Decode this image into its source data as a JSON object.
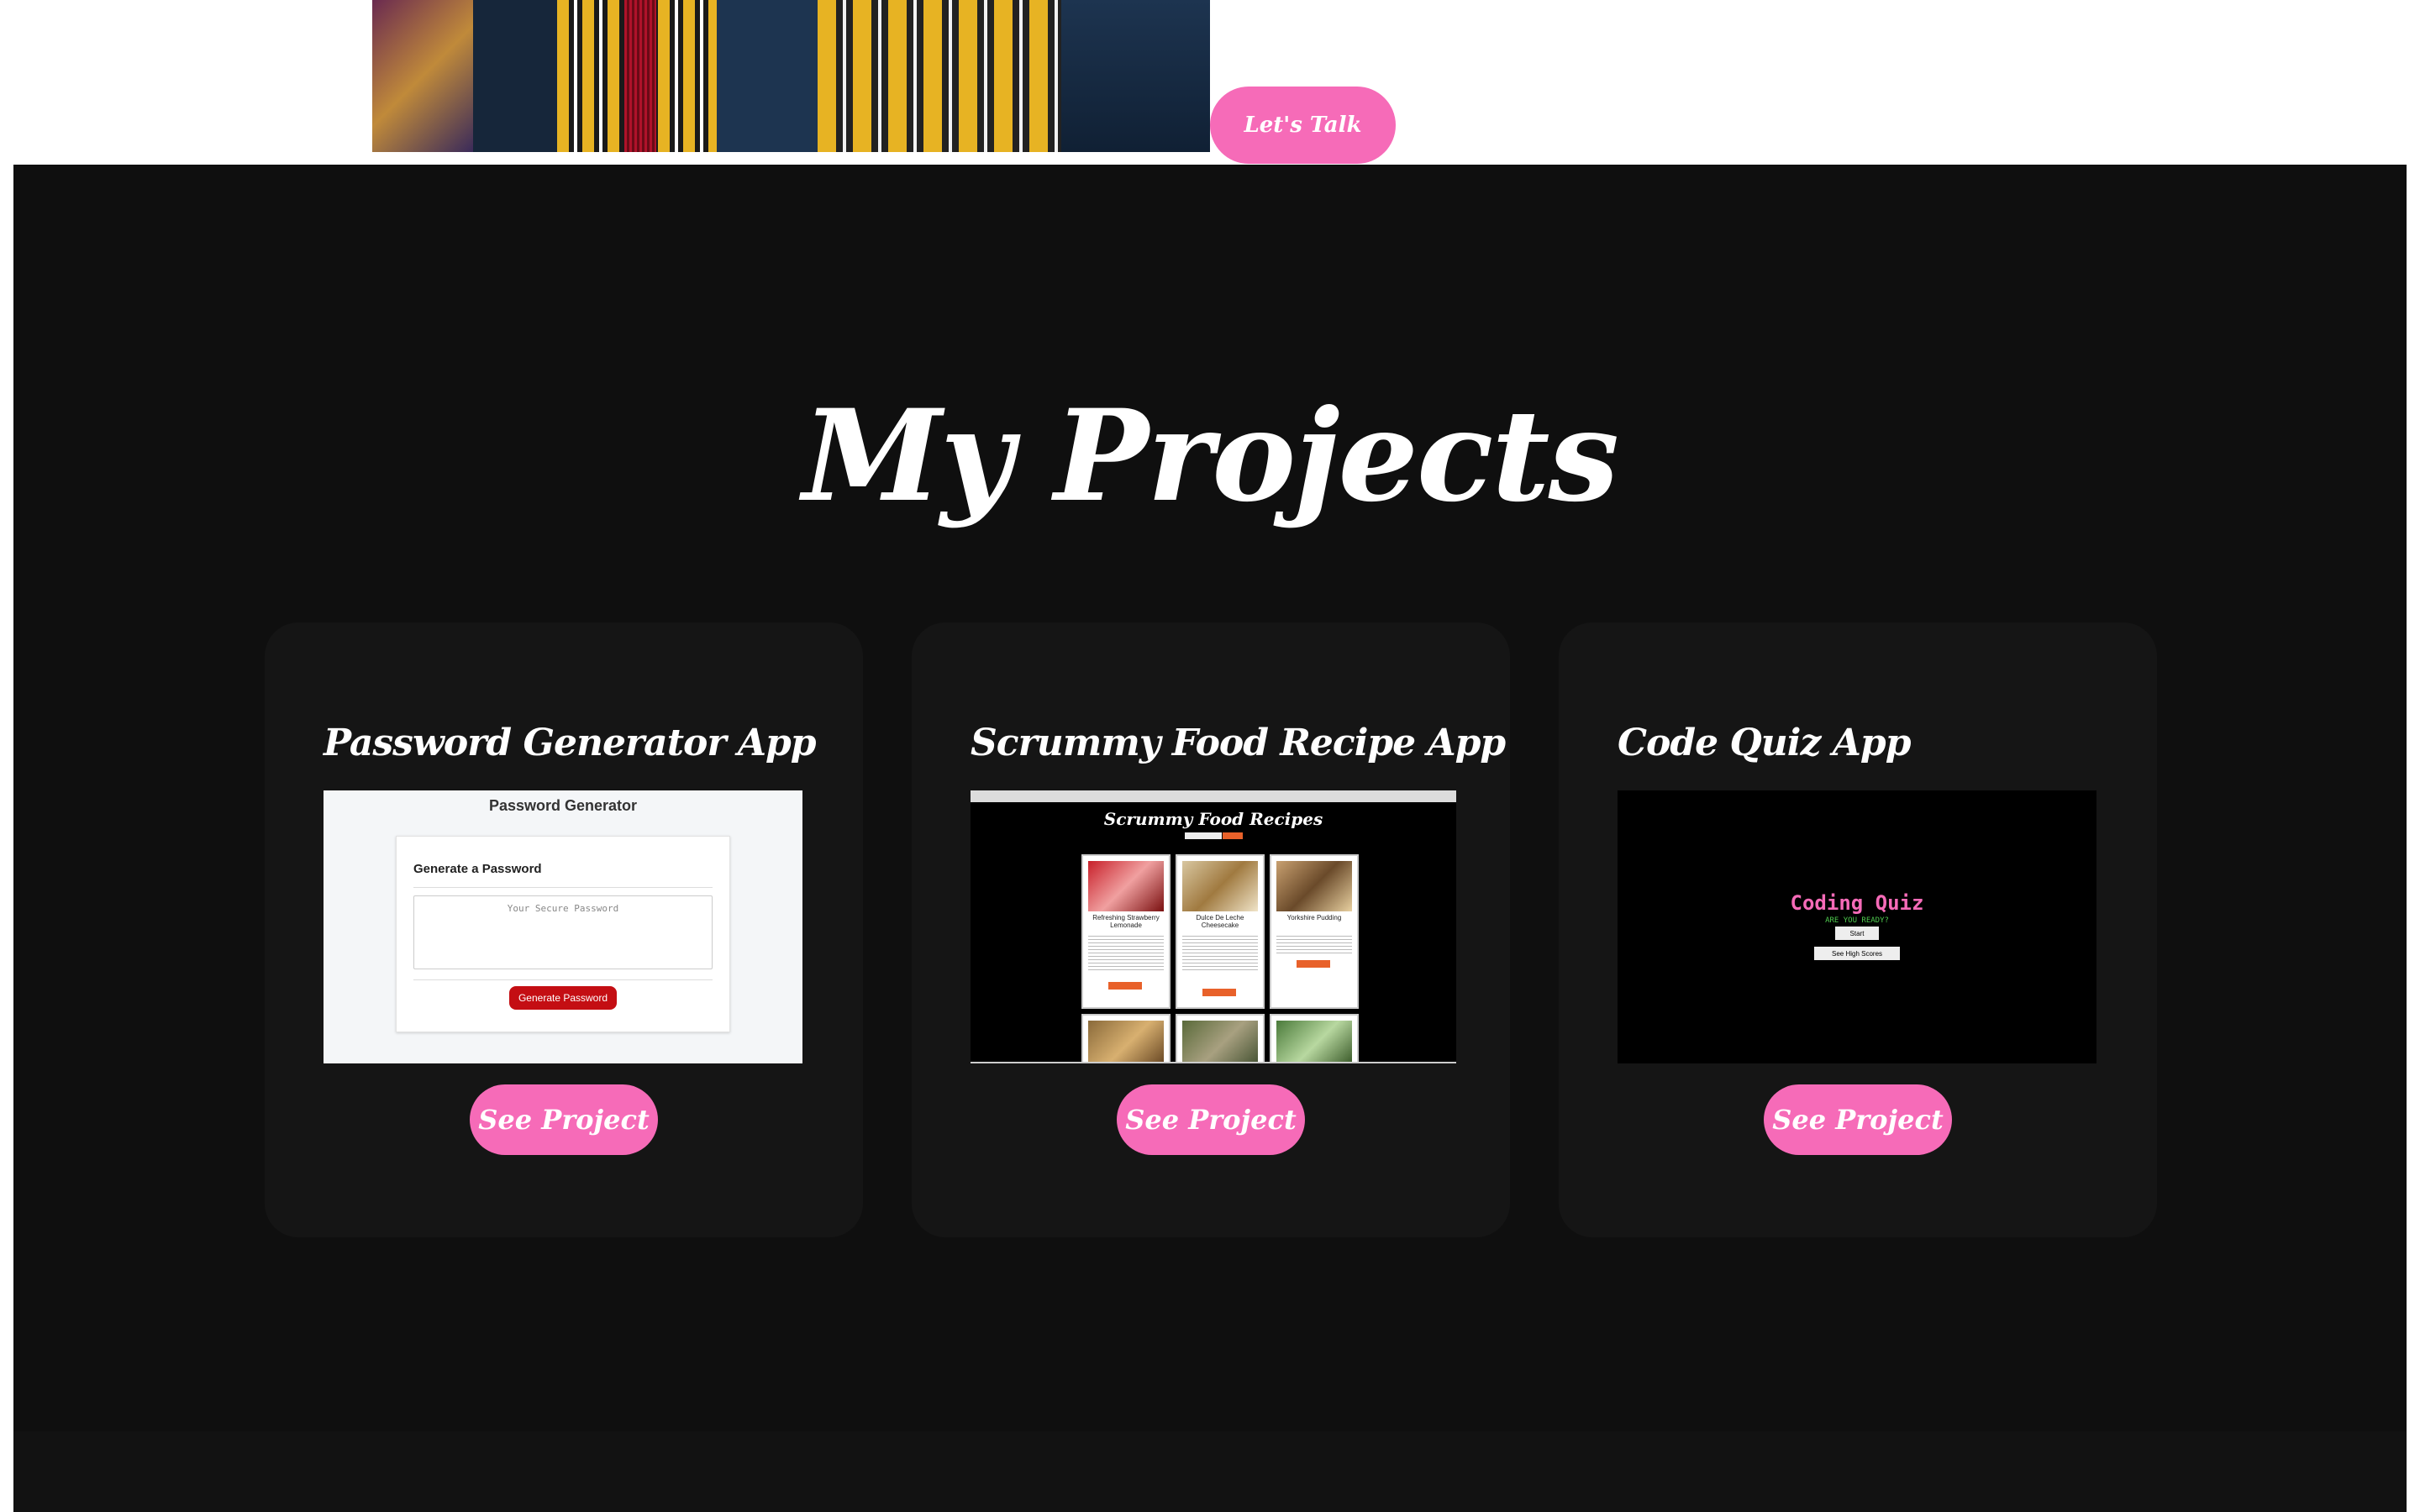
{
  "hero": {
    "cta_label": "Let's Talk",
    "photo_alt": ""
  },
  "projects": {
    "title": "My Projects",
    "items": [
      {
        "name": "Password Generator App",
        "button": "See Project",
        "thumbnail": {
          "heading": "Password Generator",
          "subheading": "Generate a Password",
          "placeholder": "Your Secure Password",
          "button": "Generate Password"
        }
      },
      {
        "name": "Scrummy Food Recipe App",
        "button": "See Project",
        "thumbnail": {
          "heading": "Scrummy Food Recipes",
          "recipes": [
            "Refreshing Strawberry Lemonade",
            "Dulce De Leche Cheesecake",
            "Yorkshire Pudding"
          ]
        }
      },
      {
        "name": "Code Quiz App",
        "button": "See Project",
        "thumbnail": {
          "heading": "Coding Quiz",
          "subheading": "ARE YOU READY?",
          "start": "Start",
          "highscores": "See High Scores"
        }
      }
    ]
  },
  "colors": {
    "accent_pink": "#f66bb8",
    "section_bg": "#0f0f0f",
    "card_bg": "#151515"
  }
}
